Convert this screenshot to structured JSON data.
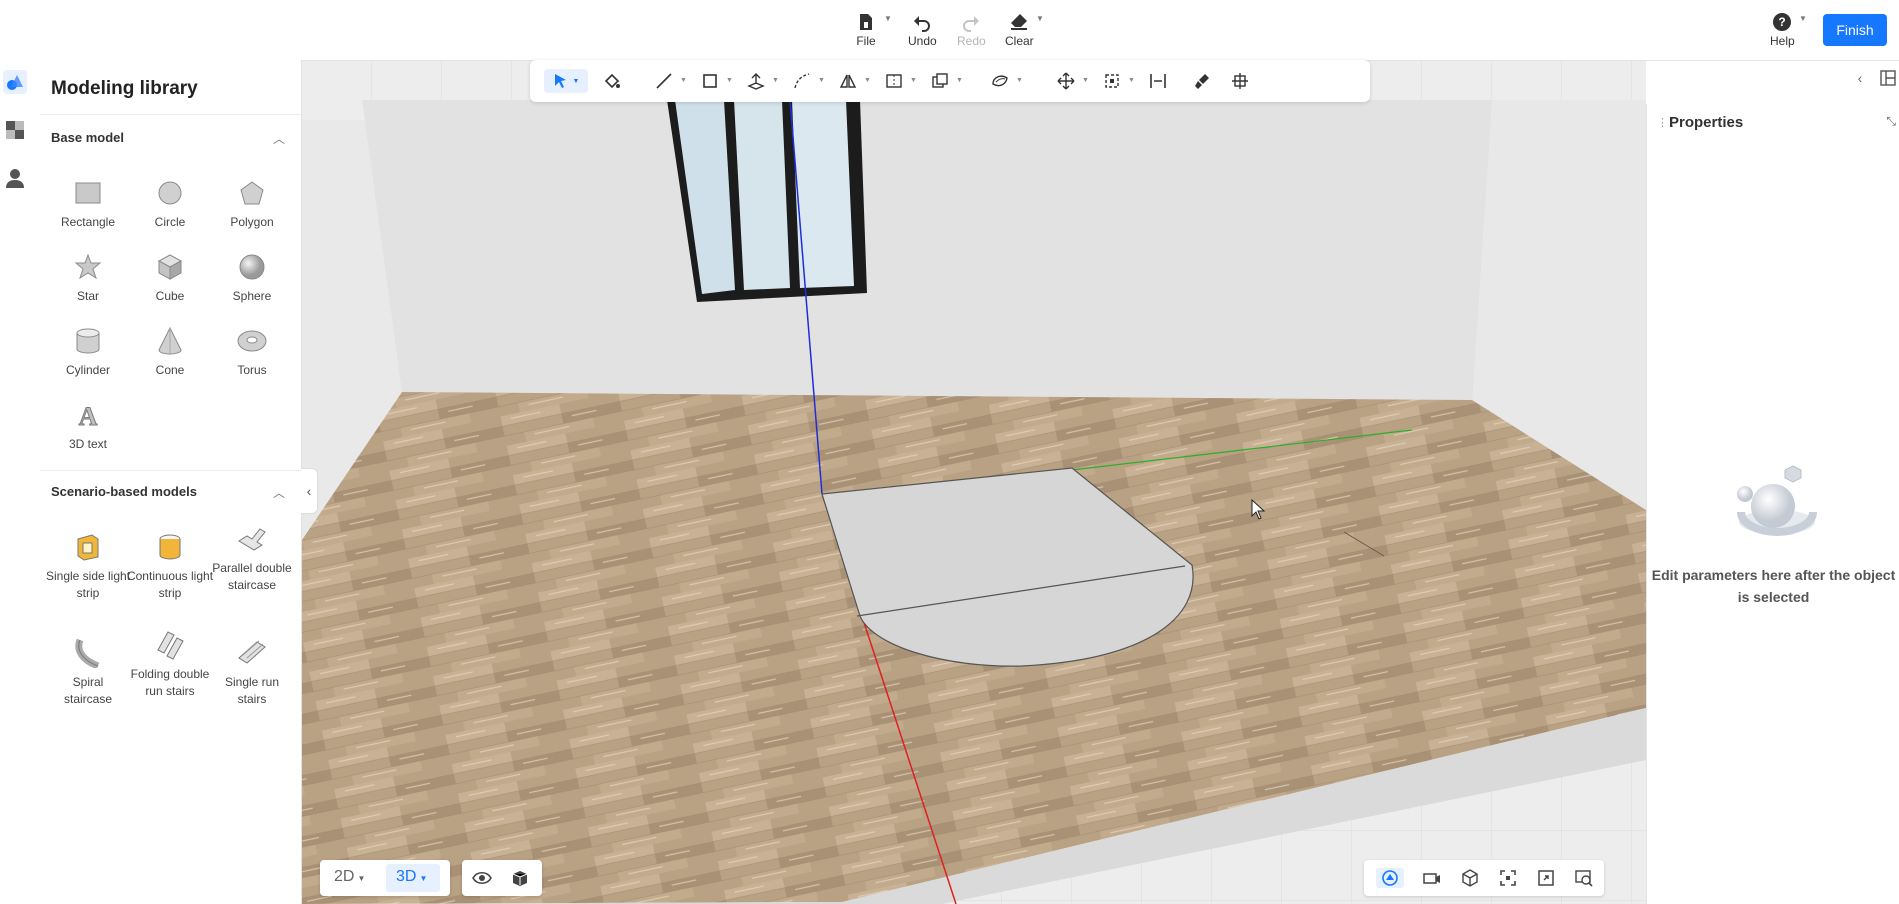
{
  "topbar": {
    "file_label": "File",
    "undo_label": "Undo",
    "redo_label": "Redo",
    "clear_label": "Clear",
    "help_label": "Help",
    "finish_label": "Finish"
  },
  "library": {
    "title": "Modeling library",
    "base_section": {
      "title": "Base model",
      "items": [
        {
          "label": "Rectangle",
          "icon": "rectangle-icon"
        },
        {
          "label": "Circle",
          "icon": "circle-icon"
        },
        {
          "label": "Polygon",
          "icon": "polygon-icon"
        },
        {
          "label": "Star",
          "icon": "star-icon"
        },
        {
          "label": "Cube",
          "icon": "cube-icon"
        },
        {
          "label": "Sphere",
          "icon": "sphere-icon"
        },
        {
          "label": "Cylinder",
          "icon": "cylinder-icon"
        },
        {
          "label": "Cone",
          "icon": "cone-icon"
        },
        {
          "label": "Torus",
          "icon": "torus-icon"
        },
        {
          "label": "3D text",
          "icon": "3d-text-icon"
        }
      ]
    },
    "scenario_section": {
      "title": "Scenario-based models",
      "items": [
        {
          "label": "Single side light strip",
          "icon": "single-side-light-strip-icon"
        },
        {
          "label": "Continuous light strip",
          "icon": "continuous-light-strip-icon"
        },
        {
          "label": "Parallel double staircase",
          "icon": "parallel-double-staircase-icon"
        },
        {
          "label": "Spiral staircase",
          "icon": "spiral-staircase-icon"
        },
        {
          "label": "Folding double run stairs",
          "icon": "folding-double-run-stairs-icon"
        },
        {
          "label": "Single run stairs",
          "icon": "single-run-stairs-icon"
        }
      ]
    }
  },
  "view": {
    "mode_2d": "2D",
    "mode_3d": "3D",
    "active_mode": "3D"
  },
  "properties": {
    "title": "Properties",
    "empty_message": "Edit parameters here after the object is selected"
  },
  "colors": {
    "accent": "#1677ff",
    "floor": "#b9a184",
    "wall": "#e2e2e2",
    "axis_x": "#e02020",
    "axis_y": "#29b02a",
    "axis_z": "#1d2fd8"
  }
}
